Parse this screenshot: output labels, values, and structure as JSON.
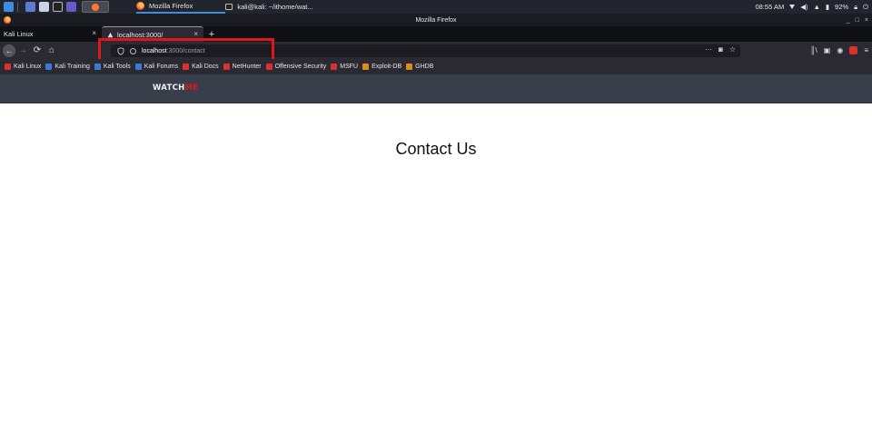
{
  "taskbar": {
    "tasks": [
      {
        "label": "Mozilla Firefox"
      },
      {
        "label": "kali@kali: ~/ithome/wat..."
      }
    ],
    "clock": "08:55 AM",
    "battery": "92%"
  },
  "window": {
    "title": "Mozilla Firefox",
    "controls": [
      "_",
      "□",
      "×"
    ]
  },
  "tabs": [
    {
      "label": "Kali Linux",
      "close": "×"
    },
    {
      "label": "localhost:3000/",
      "close": "×"
    }
  ],
  "newtab_label": "+",
  "nav": {
    "back": "←",
    "forward": "→",
    "reload": "⟳",
    "home": "⌂",
    "url_host": "localhost",
    "url_path": ":3000/contact",
    "more": "···"
  },
  "bookmarks": [
    {
      "label": "Kali Linux",
      "color": "#d93030"
    },
    {
      "label": "Kali Training",
      "color": "#3a7bd5"
    },
    {
      "label": "Kali Tools",
      "color": "#3a7bd5"
    },
    {
      "label": "Kali Forums",
      "color": "#3a7bd5"
    },
    {
      "label": "Kali Docs",
      "color": "#d93030"
    },
    {
      "label": "NetHunter",
      "color": "#d93030"
    },
    {
      "label": "Offensive Security",
      "color": "#d93030"
    },
    {
      "label": "MSFU",
      "color": "#d93030"
    },
    {
      "label": "Exploit-DB",
      "color": "#e08a1e"
    },
    {
      "label": "GHDB",
      "color": "#e08a1e"
    }
  ],
  "site": {
    "logo_main": "WATCH",
    "logo_accent": "ME",
    "heading": "Contact Us"
  },
  "colors": {
    "highlight_box": "#e0161b",
    "site_header_bg": "#383e4a",
    "logo_accent": "#e0161b"
  }
}
